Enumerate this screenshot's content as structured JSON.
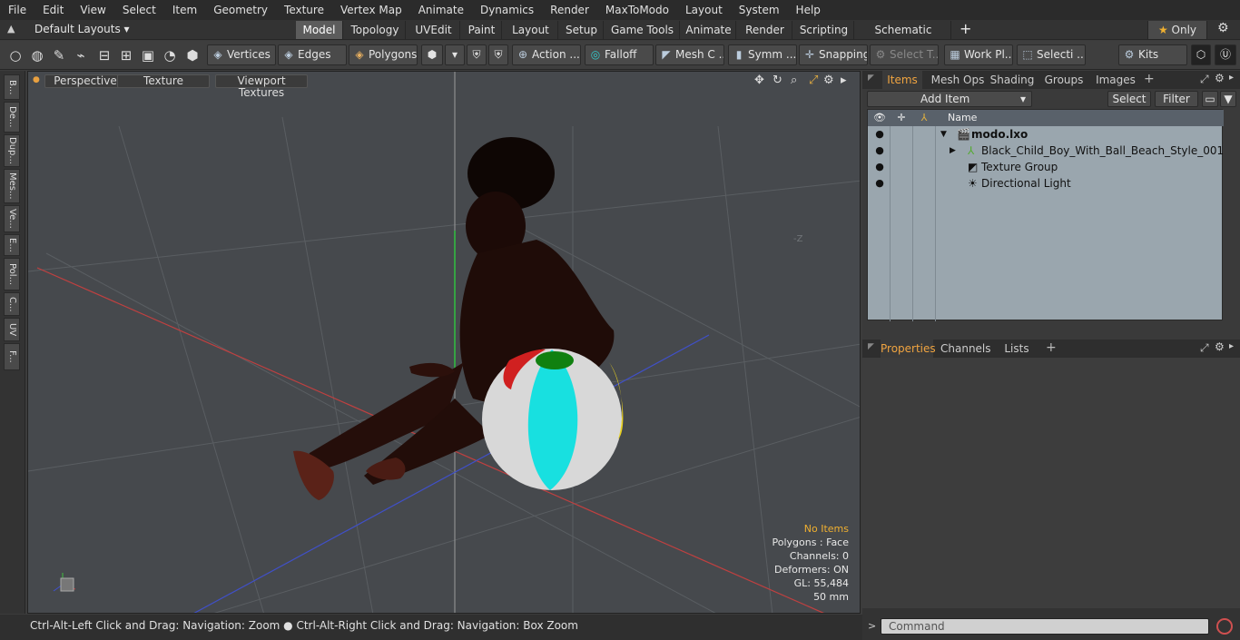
{
  "menu": [
    "File",
    "Edit",
    "View",
    "Select",
    "Item",
    "Geometry",
    "Texture",
    "Vertex Map",
    "Animate",
    "Dynamics",
    "Render",
    "MaxToModo",
    "Layout",
    "System",
    "Help"
  ],
  "layouts": {
    "selector": "Default Layouts",
    "tabs": [
      "Model",
      "Topology",
      "UVEdit",
      "Paint",
      "Layout",
      "Setup",
      "Game Tools",
      "Animate",
      "Render",
      "Scripting",
      "Schematic Fusion"
    ],
    "add": "+",
    "only": "Only"
  },
  "toolbar": {
    "vertices": "Vertices",
    "edges": "Edges",
    "polygons": "Polygons",
    "action": "Action ...",
    "falloff": "Falloff",
    "meshc": "Mesh C ...",
    "symm": "Symm ...",
    "snapping": "Snapping",
    "selectt": "Select T...",
    "workpl": "Work Pl...",
    "selecti": "Selecti ...",
    "kits": "Kits"
  },
  "lefttabs": [
    "B...",
    "De...",
    "Dup...",
    "Mes...",
    "Ve...",
    "E...",
    "Pol...",
    "C...",
    "UV",
    "F..."
  ],
  "viewport": {
    "view": "Perspective",
    "shading": "Texture",
    "textures": "Viewport Textures",
    "axis_z_label": "-Z",
    "info": {
      "title": "No Items",
      "polygons": "Polygons : Face",
      "channels": "Channels: 0",
      "deformers": "Deformers: ON",
      "gl": "GL: 55,484",
      "units": "50 mm"
    }
  },
  "status": "Ctrl-Alt-Left Click and Drag: Navigation: Zoom ● Ctrl-Alt-Right Click and Drag: Navigation: Box Zoom",
  "items_panel": {
    "tabs": [
      "Items",
      "Mesh Ops",
      "Shading",
      "Groups",
      "Images"
    ],
    "add_item": "Add Item",
    "select": "Select",
    "filter": "Filter",
    "column_name": "Name",
    "tree": [
      "modo.lxo",
      "Black_Child_Boy_With_Ball_Beach_Style_001",
      "Texture Group",
      "Directional Light"
    ]
  },
  "properties_panel": {
    "tabs": [
      "Properties",
      "Channels",
      "Lists"
    ]
  },
  "command": {
    "placeholder": "Command"
  }
}
